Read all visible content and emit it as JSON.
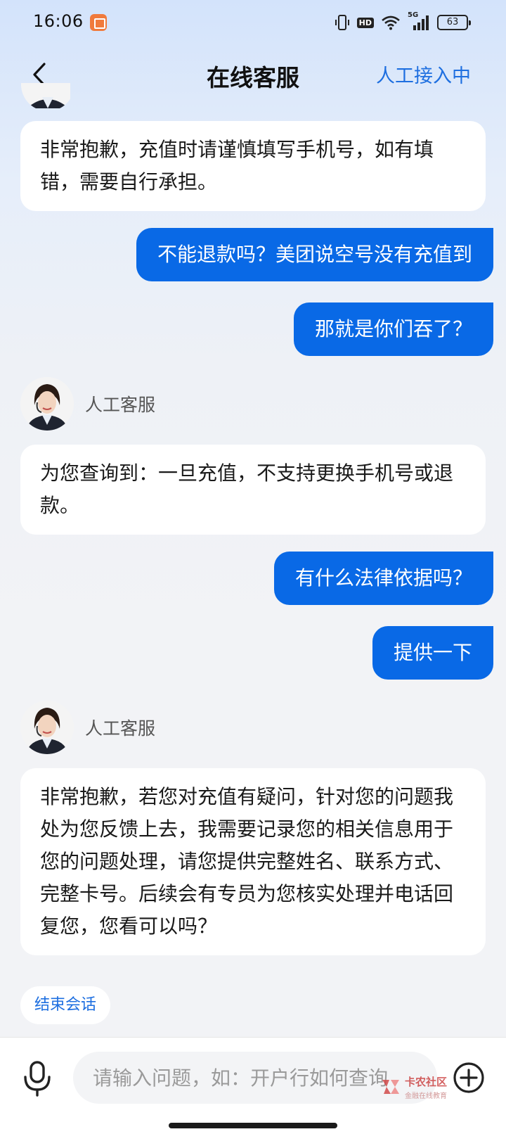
{
  "status_bar": {
    "time": "16:06",
    "network": "5G",
    "hd": "HD",
    "battery": "63"
  },
  "header": {
    "title": "在线客服",
    "status": "人工接入中"
  },
  "messages": [
    {
      "from": "agent",
      "text": "非常抱歉，充值时请谨慎填写手机号，如有填错，需要自行承担。"
    },
    {
      "from": "user",
      "text": "不能退款吗？美团说空号没有充值到"
    },
    {
      "from": "user",
      "text": "那就是你们吞了？"
    },
    {
      "from": "agent",
      "name": "人工客服",
      "text": "为您查询到：一旦充值，不支持更换手机号或退款。"
    },
    {
      "from": "user",
      "text": "有什么法律依据吗？"
    },
    {
      "from": "user",
      "text": "提供一下"
    },
    {
      "from": "agent",
      "name": "人工客服",
      "text": "非常抱歉，若您对充值有疑问，针对您的问题我处为您反馈上去，我需要记录您的相关信息用于您的问题处理，请您提供完整姓名、联系方式、完整卡号。后续会有专员为您核实处理并电话回复您，您看可以吗？"
    }
  ],
  "agent_label": "人工客服",
  "end_chat_label": "结束会话",
  "input": {
    "placeholder": "请输入问题，如：开户行如何查询",
    "value": ""
  },
  "watermark": {
    "title": "卡农社区",
    "subtitle": "金融在线教育"
  },
  "colors": {
    "accent": "#0969e6",
    "link": "#1e6fe0"
  }
}
